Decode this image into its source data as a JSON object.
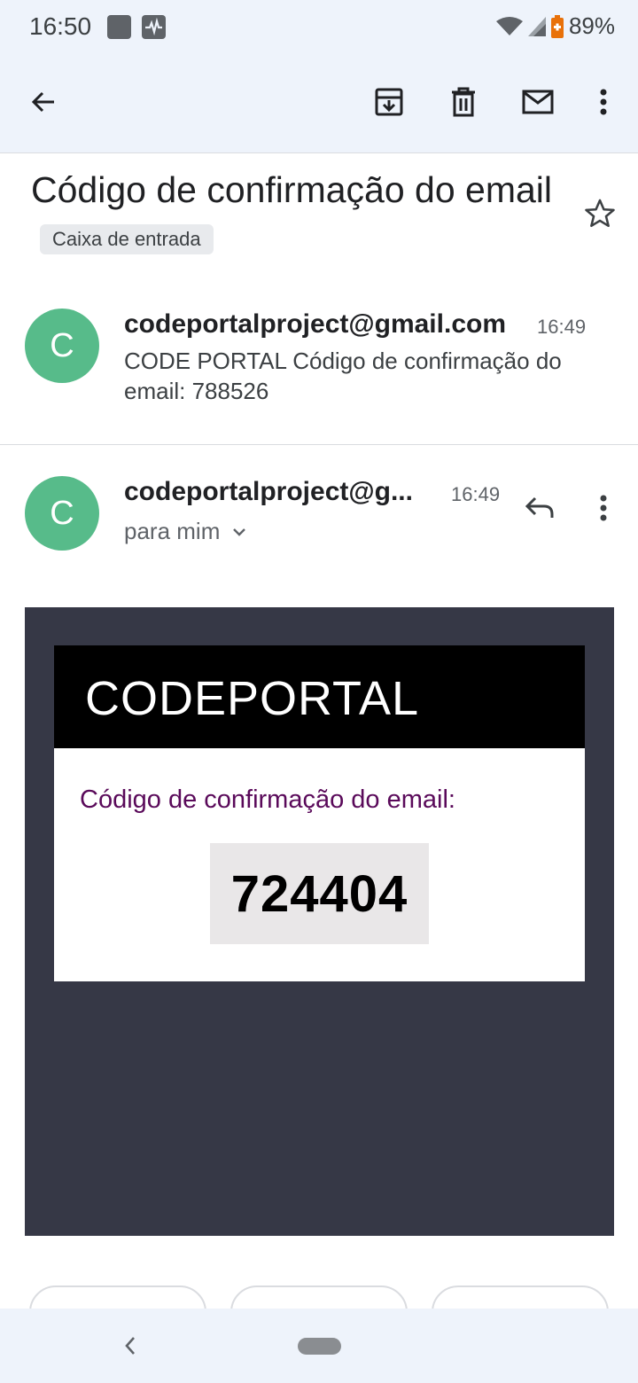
{
  "status_bar": {
    "time": "16:50",
    "battery": "89%"
  },
  "message": {
    "subject": "Código de confirmação do email",
    "label": "Caixa de entrada"
  },
  "collapsed_message": {
    "avatar_letter": "C",
    "sender": "codeportalproject@gmail.com",
    "time": "16:49",
    "snippet": "CODE PORTAL Código de confirmação do email: 788526"
  },
  "expanded_message": {
    "avatar_letter": "C",
    "sender": "codeportalproject@g...",
    "time": "16:49",
    "recipient": "para mim"
  },
  "email_body": {
    "brand": "CODEPORTAL",
    "heading": "Código de confirmação do email:",
    "code": "724404",
    "colors": {
      "background": "#363846",
      "heading": "#5a0a5a"
    }
  },
  "icons": [
    "back-arrow-icon",
    "archive-icon",
    "delete-icon",
    "mail-icon",
    "more-vert-icon",
    "star-icon",
    "reply-icon",
    "chevron-down-icon"
  ]
}
